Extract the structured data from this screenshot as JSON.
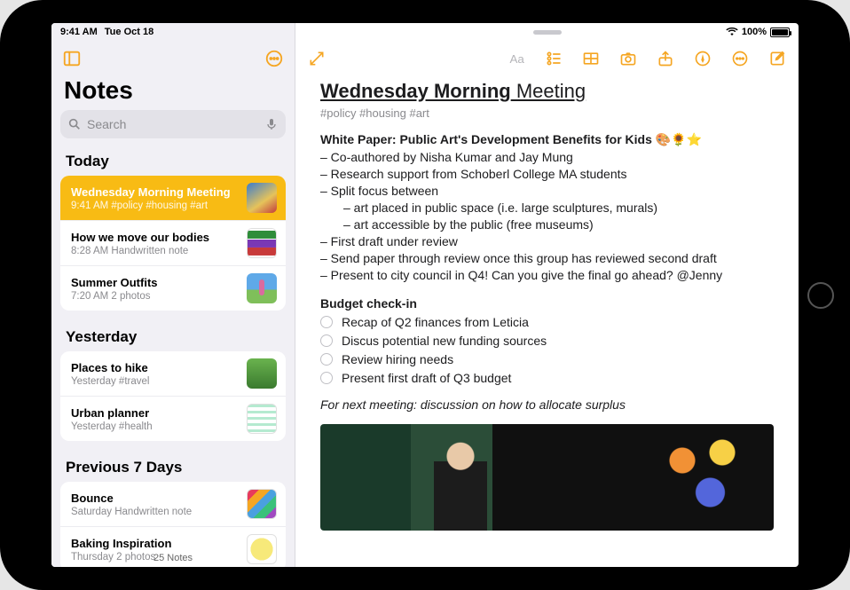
{
  "status": {
    "time": "9:41 AM",
    "date": "Tue Oct 18",
    "battery_pct": "100%"
  },
  "sidebar": {
    "title": "Notes",
    "search_placeholder": "Search",
    "footer": "25 Notes",
    "sections": [
      {
        "header": "Today",
        "items": [
          {
            "title": "Wednesday Morning Meeting",
            "sub": "9:41 AM  #policy #housing #art",
            "selected": true,
            "thumb": "th1"
          },
          {
            "title": "How we move our bodies",
            "sub": "8:28 AM  Handwritten note",
            "thumb": "th2"
          },
          {
            "title": "Summer Outfits",
            "sub": "7:20 AM  2 photos",
            "thumb": "th3"
          }
        ]
      },
      {
        "header": "Yesterday",
        "items": [
          {
            "title": "Places to hike",
            "sub": "Yesterday  #travel",
            "thumb": "th4"
          },
          {
            "title": "Urban planner",
            "sub": "Yesterday  #health",
            "thumb": "th5"
          }
        ]
      },
      {
        "header": "Previous 7 Days",
        "items": [
          {
            "title": "Bounce",
            "sub": "Saturday  Handwritten note",
            "thumb": "th6"
          },
          {
            "title": "Baking Inspiration",
            "sub": "Thursday  2 photos",
            "thumb": "th7"
          }
        ]
      }
    ]
  },
  "note": {
    "title_bold": "Wednesday Morning",
    "title_rest": " Meeting",
    "tags": "#policy #housing #art",
    "heading1": "White Paper: Public Art's Development Benefits for Kids 🎨🌻⭐",
    "bullets": [
      "– Co-authored by Nisha Kumar and Jay Mung",
      "– Research support from Schoberl College MA students",
      "– Split focus between"
    ],
    "sub_bullets": [
      "– art placed in public space (i.e. large sculptures, murals)",
      "– art accessible by the public (free museums)"
    ],
    "bullets2": [
      "– First draft under review",
      "– Send paper through review once this group has reviewed second draft",
      "– Present to city council in Q4! Can you give the final go ahead? @Jenny"
    ],
    "heading2": "Budget check-in",
    "checks": [
      "Recap of Q2 finances from Leticia",
      "Discus potential new funding sources",
      "Review hiring needs",
      "Present first draft of Q3 budget"
    ],
    "italic": "For next meeting: discussion on how to allocate surplus"
  }
}
